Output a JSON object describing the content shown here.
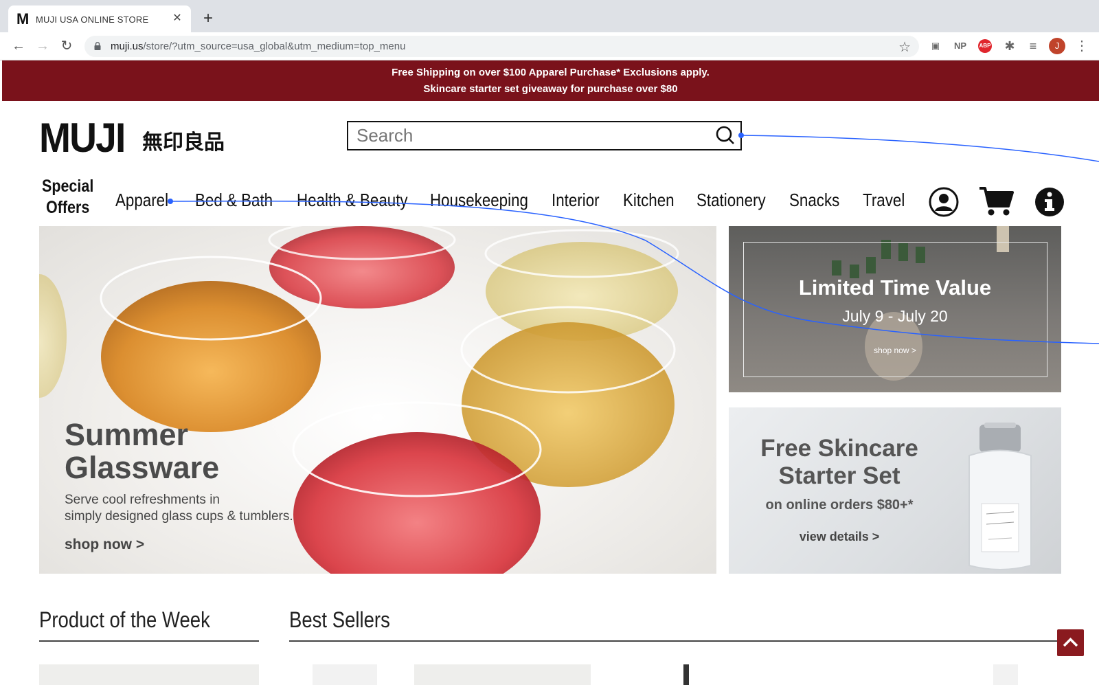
{
  "browser": {
    "tab_title": "MUJI USA ONLINE STORE",
    "tab_favicon": "M",
    "url_host": "muji.us",
    "url_path": "/store/?utm_source=usa_global&utm_medium=top_menu",
    "profile_initial": "J",
    "ext_np": "NP",
    "ext_abp": "ABP"
  },
  "promo": {
    "line1": "Free Shipping on over $100 Apparel Purchase* Exclusions apply.",
    "line2": "Skincare starter set giveaway for purchase over $80"
  },
  "header": {
    "logo_en": "MUJI",
    "logo_jp": "無印良品",
    "search_placeholder": "Search"
  },
  "nav": {
    "special_line1": "Special",
    "special_line2": "Offers",
    "items": [
      "Apparel",
      "Bed & Bath",
      "Health & Beauty",
      "Housekeeping",
      "Interior",
      "Kitchen",
      "Stationery",
      "Snacks",
      "Travel"
    ]
  },
  "hero": {
    "title_line1": "Summer",
    "title_line2": "Glassware",
    "sub_line1": "Serve cool refreshments in",
    "sub_line2": "simply designed glass cups & tumblers.",
    "cta": "shop now >"
  },
  "side_limited": {
    "title": "Limited Time Value",
    "dates": "July 9 - July 20",
    "cta": "shop now >"
  },
  "side_skincare": {
    "title_line1": "Free Skincare",
    "title_line2": "Starter Set",
    "subtitle": "on online orders $80+*",
    "cta": "view details >"
  },
  "sections": {
    "product_of_week": "Product of the Week",
    "best_sellers": "Best Sellers"
  },
  "colors": {
    "promo_bg": "#7a121b",
    "scroll_top_bg": "#8a1a1f",
    "trace_line": "#2962ff"
  }
}
